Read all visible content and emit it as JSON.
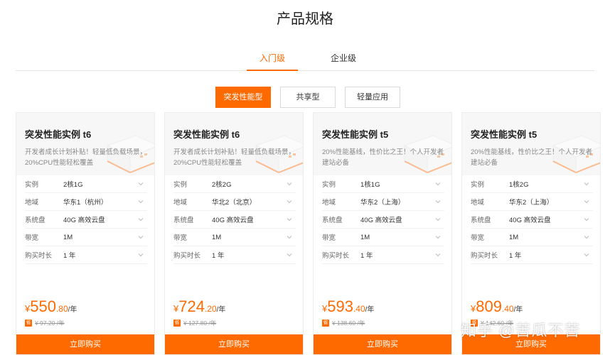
{
  "page": {
    "title": "产品规格"
  },
  "tabs": [
    {
      "label": "入门级",
      "active": true
    },
    {
      "label": "企业级",
      "active": false
    }
  ],
  "types": [
    {
      "label": "突发性能型",
      "active": true
    },
    {
      "label": "共享型",
      "active": false
    },
    {
      "label": "轻量应用",
      "active": false
    }
  ],
  "spec_labels": {
    "instance": "实例",
    "region": "地域",
    "disk": "系统盘",
    "bandwidth": "带宽",
    "duration": "购买时长"
  },
  "buy_label": "立即购买",
  "cards": [
    {
      "title": "突发性能实例 t6",
      "desc": "开发者成长计划补贴！轻量低负载场景，20%CPU性能轻松覆盖",
      "instance": "2核1G",
      "region": "华东1（杭州）",
      "disk": "40G 高效云盘",
      "bandwidth": "1M",
      "duration": "1 年",
      "price_currency": "¥",
      "price_int": "550",
      "price_dec": ".80",
      "price_unit": "/年",
      "orig_badge": "省",
      "orig_price": "¥ 97.20 /年"
    },
    {
      "title": "突发性能实例 t6",
      "desc": "开发者成长计划补贴！轻量低负载场景，20%CPU性能轻松覆盖",
      "instance": "2核2G",
      "region": "华北2（北京）",
      "disk": "40G 高效云盘",
      "bandwidth": "1M",
      "duration": "1 年",
      "price_currency": "¥",
      "price_int": "724",
      "price_dec": ".20",
      "price_unit": "/年",
      "orig_badge": "省",
      "orig_price": "¥ 127.80 /年"
    },
    {
      "title": "突发性能实例 t5",
      "desc": "20%性能基线，性价比之王！个人开发者建站必备",
      "instance": "1核1G",
      "region": "华东2（上海）",
      "disk": "40G 高效云盘",
      "bandwidth": "1M",
      "duration": "1 年",
      "price_currency": "¥",
      "price_int": "593",
      "price_dec": ".40",
      "price_unit": "/年",
      "orig_badge": "省",
      "orig_price": "¥ 138.60 /年"
    },
    {
      "title": "突发性能实例 t5",
      "desc": "20%性能基线，性价比之王！个人开发者建站必备",
      "instance": "1核2G",
      "region": "华东2（上海）",
      "disk": "40G 高效云盘",
      "bandwidth": "1M",
      "duration": "1 年",
      "price_currency": "¥",
      "price_int": "809",
      "price_dec": ".40",
      "price_unit": "/年",
      "orig_badge": "省",
      "orig_price": "¥ 142.60 /年"
    }
  ],
  "watermark": "知乎 @苦瓜不苦",
  "colors": {
    "accent": "#ff6a00",
    "text": "#333333",
    "muted": "#999999"
  },
  "icons": {
    "spec_dropdown": "chevron-down-icon",
    "server": "server-icon"
  }
}
